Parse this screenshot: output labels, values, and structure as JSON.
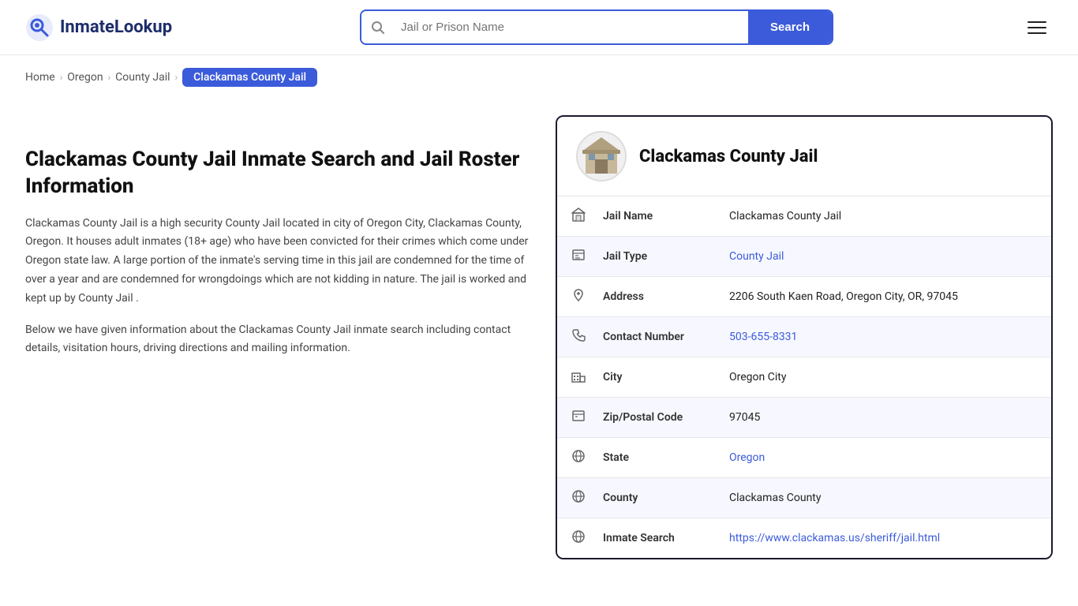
{
  "header": {
    "logo_text": "InmateLookup",
    "search_placeholder": "Jail or Prison Name",
    "search_button_label": "Search"
  },
  "breadcrumb": {
    "items": [
      {
        "label": "Home",
        "href": "#",
        "active": false
      },
      {
        "label": "Oregon",
        "href": "#",
        "active": false
      },
      {
        "label": "County Jail",
        "href": "#",
        "active": false
      },
      {
        "label": "Clackamas County Jail",
        "href": "#",
        "active": true
      }
    ]
  },
  "left": {
    "title": "Clackamas County Jail Inmate Search and Jail Roster Information",
    "description1": "Clackamas County Jail is a high security County Jail located in city of Oregon City, Clackamas County, Oregon. It houses adult inmates (18+ age) who have been convicted for their crimes which come under Oregon state law. A large portion of the inmate's serving time in this jail are condemned for the time of over a year and are condemned for wrongdoings which are not kidding in nature. The jail is worked and kept up by County Jail .",
    "description2": "Below we have given information about the Clackamas County Jail inmate search including contact details, visitation hours, driving directions and mailing information."
  },
  "card": {
    "jail_name": "Clackamas County Jail",
    "fields": [
      {
        "icon": "jail-icon",
        "label": "Jail Name",
        "value": "Clackamas County Jail",
        "type": "text"
      },
      {
        "icon": "type-icon",
        "label": "Jail Type",
        "value": "County Jail",
        "type": "link",
        "href": "#"
      },
      {
        "icon": "address-icon",
        "label": "Address",
        "value": "2206 South Kaen Road, Oregon City, OR, 97045",
        "type": "text"
      },
      {
        "icon": "phone-icon",
        "label": "Contact Number",
        "value": "503-655-8331",
        "type": "link",
        "href": "tel:503-655-8331"
      },
      {
        "icon": "city-icon",
        "label": "City",
        "value": "Oregon City",
        "type": "text"
      },
      {
        "icon": "zip-icon",
        "label": "Zip/Postal Code",
        "value": "97045",
        "type": "text"
      },
      {
        "icon": "state-icon",
        "label": "State",
        "value": "Oregon",
        "type": "link",
        "href": "#"
      },
      {
        "icon": "county-icon",
        "label": "County",
        "value": "Clackamas County",
        "type": "text"
      },
      {
        "icon": "inmate-icon",
        "label": "Inmate Search",
        "value": "https://www.clackamas.us/sheriff/jail.html",
        "type": "link",
        "href": "https://www.clackamas.us/sheriff/jail.html"
      }
    ]
  },
  "colors": {
    "accent": "#3b5bdb",
    "dark": "#1a1a2e"
  }
}
